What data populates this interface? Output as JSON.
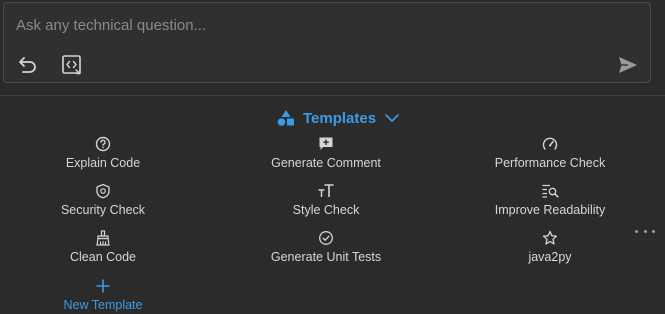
{
  "chat": {
    "placeholder": "Ask any technical question..."
  },
  "templates": {
    "title": "Templates",
    "items": [
      {
        "label": "Explain Code",
        "icon": "help-circle-icon"
      },
      {
        "label": "Generate Comment",
        "icon": "comment-add-icon"
      },
      {
        "label": "Performance Check",
        "icon": "gauge-icon"
      },
      {
        "label": "Security Check",
        "icon": "shield-icon"
      },
      {
        "label": "Style Check",
        "icon": "text-size-icon"
      },
      {
        "label": "Improve Readability",
        "icon": "search-list-icon"
      },
      {
        "label": "Clean Code",
        "icon": "broom-icon"
      },
      {
        "label": "Generate Unit Tests",
        "icon": "check-circle-icon"
      },
      {
        "label": "java2py",
        "icon": "star-icon"
      }
    ],
    "new_template_label": "New Template"
  },
  "colors": {
    "accent": "#3c9be6",
    "background": "#2b2b2b",
    "text": "#d6d6d6"
  }
}
